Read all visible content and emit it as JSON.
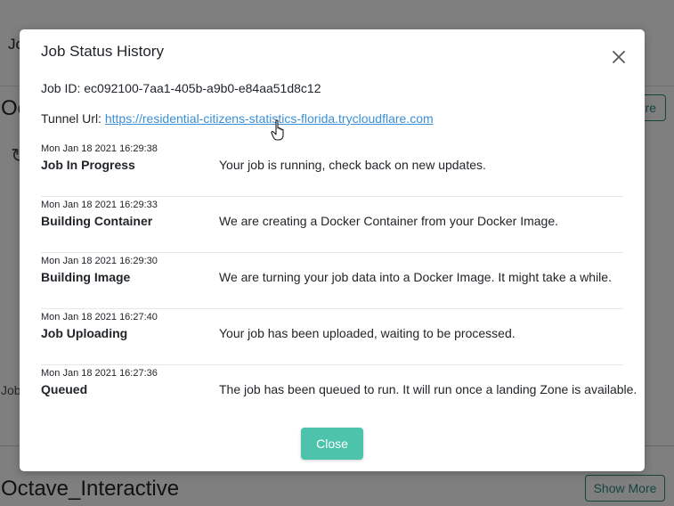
{
  "background": {
    "header_text": "Jo",
    "section_title_partial": "Oc",
    "more_button_partial": "re",
    "spinner_icon": "refresh-icon",
    "job_label_partial": "Job",
    "next_section_title": "Octave_Interactive",
    "show_more_label": "Show More"
  },
  "modal": {
    "title": "Job Status History",
    "close_icon": "close-icon",
    "job_id_label": "Job ID:",
    "job_id_value": "ec092100-7aa1-405b-a9b0-e84aa51d8c12",
    "tunnel_label": "Tunnel Url:",
    "tunnel_url": "https://residential-citizens-statistics-florida.trycloudflare.com",
    "statuses": [
      {
        "time": "Mon Jan 18 2021 16:29:38",
        "name": "Job In Progress",
        "description": "Your job is running, check back on new updates."
      },
      {
        "time": "Mon Jan 18 2021 16:29:33",
        "name": "Building Container",
        "description": "We are creating a Docker Container from your Docker Image."
      },
      {
        "time": "Mon Jan 18 2021 16:29:30",
        "name": "Building Image",
        "description": "We are turning your job data into a Docker Image. It might take a while."
      },
      {
        "time": "Mon Jan 18 2021 16:27:40",
        "name": "Job Uploading",
        "description": "Your job has been uploaded, waiting to be processed."
      },
      {
        "time": "Mon Jan 18 2021 16:27:36",
        "name": "Queued",
        "description": "The job has been queued to run. It will run once a landing Zone is available."
      }
    ],
    "close_button_label": "Close"
  },
  "colors": {
    "accent": "#4ec3ab",
    "link": "#3a8fd6",
    "outline_button": "#2a8a7a",
    "overlay": "rgba(0,0,0,0.5)"
  }
}
